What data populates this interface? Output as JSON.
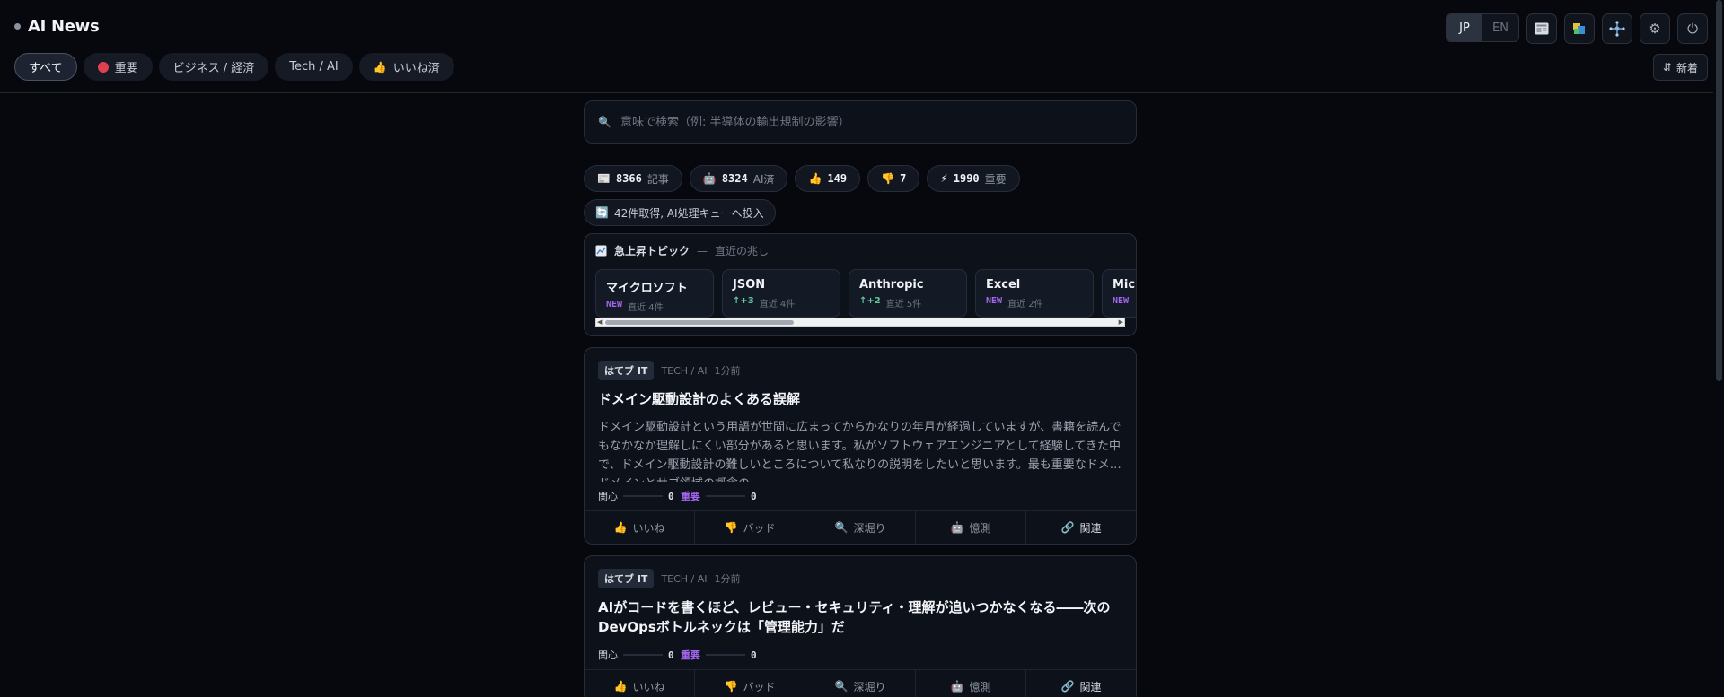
{
  "app": {
    "title": "AI News"
  },
  "filters": [
    {
      "label": "すべて",
      "active": true
    },
    {
      "label": "重要",
      "icon": "red-dot"
    },
    {
      "label": "ビジネス / 経済"
    },
    {
      "label": "Tech / AI"
    },
    {
      "label": "いいね済",
      "icon": "👍"
    }
  ],
  "lang": {
    "jp": "JP",
    "en": "EN"
  },
  "toolbar_icons": [
    "newspaper-icon",
    "palette-icon",
    "network-icon",
    "gear-icon",
    "power-icon"
  ],
  "sort": {
    "label": "新着",
    "icon": "⇵"
  },
  "search": {
    "placeholder": "意味で検索（例: 半導体の輸出規制の影響）",
    "icon": "🔍"
  },
  "stats": [
    {
      "icon": "📰",
      "value": "8366",
      "label": "記事"
    },
    {
      "icon": "🤖",
      "value": "8324",
      "label": "AI済"
    },
    {
      "icon": "👍",
      "value": "149",
      "label": ""
    },
    {
      "icon": "👎",
      "value": "7",
      "label": ""
    },
    {
      "icon": "⚡",
      "value": "1990",
      "label": "重要"
    }
  ],
  "queue": {
    "icon": "🔄",
    "text": "42件取得, AI処理キューへ投入"
  },
  "trending": {
    "title": "急上昇トピック",
    "sep": "—",
    "subtitle": "直近の兆し",
    "items": [
      {
        "name": "マイクロソフト",
        "tag": "NEW",
        "recent": "直近 4件",
        "kind": "new"
      },
      {
        "name": "JSON",
        "tag": "↑+3",
        "recent": "直近 4件",
        "kind": "up"
      },
      {
        "name": "Anthropic",
        "tag": "↑+2",
        "recent": "直近 5件",
        "kind": "up"
      },
      {
        "name": "Excel",
        "tag": "NEW",
        "recent": "直近 2件",
        "kind": "new"
      },
      {
        "name": "Mic",
        "tag": "NEW",
        "recent": "",
        "kind": "new"
      }
    ]
  },
  "articles": [
    {
      "source": "はてブ IT",
      "category": "TECH / AI",
      "time": "1分前",
      "title": "ドメイン駆動設計のよくある誤解",
      "desc": "ドメイン駆動設計という用語が世間に広まってからかなりの年月が経過していますが、書籍を読んでもなかなか理解しにくい部分があると思います。私がソフトウェアエンジニアとして経験してきた中で、ドメイン駆動設計の難しいところについて私なりの説明をしたいと思います。最も重要なドメ…",
      "desc_tail": "ドメインとサブ領域の概念の",
      "interest_label": "関心",
      "interest": "0",
      "importance_label": "重要",
      "importance": "0"
    },
    {
      "source": "はてブ IT",
      "category": "TECH / AI",
      "time": "1分前",
      "title": "AIがコードを書くほど、レビュー・セキュリティ・理解が追いつかなくなる――次のDevOpsボトルネックは「管理能力」だ",
      "desc": "",
      "interest_label": "関心",
      "interest": "0",
      "importance_label": "重要",
      "importance": "0"
    }
  ],
  "actions": [
    {
      "icon": "👍",
      "label": "いいね"
    },
    {
      "icon": "👎",
      "label": "バッド"
    },
    {
      "icon": "🔍",
      "label": "深堀り"
    },
    {
      "icon": "🤖",
      "label": "憶測"
    },
    {
      "icon": "🔗",
      "label": "関連"
    }
  ]
}
